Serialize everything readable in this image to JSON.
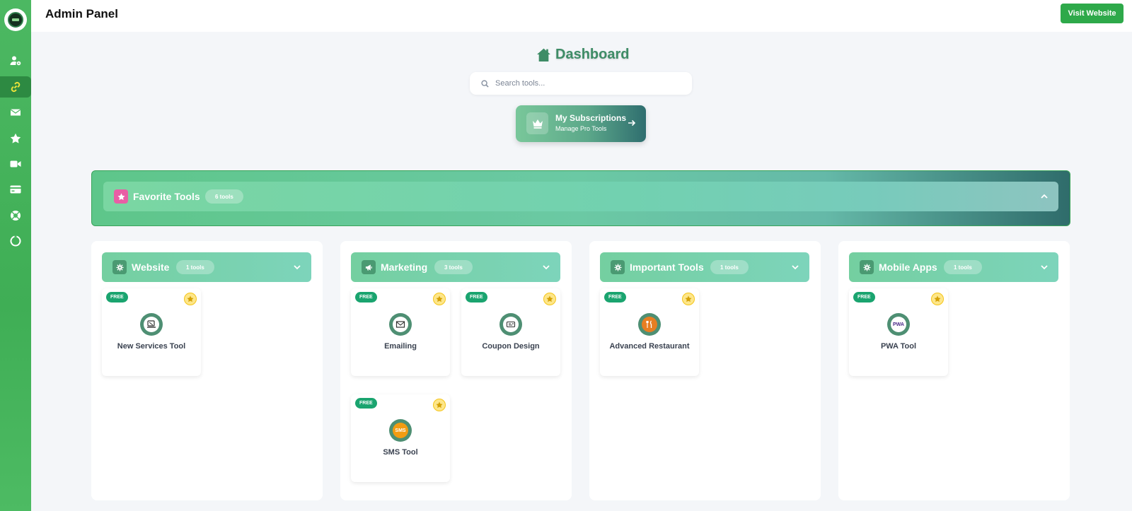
{
  "topbar": {
    "title": "Admin Panel",
    "visit_label": "Visit Website"
  },
  "sidebar": {
    "items": [
      {
        "icon": "user-gear-icon"
      },
      {
        "icon": "link-icon",
        "active": true
      },
      {
        "icon": "envelope-icon"
      },
      {
        "icon": "star-icon"
      },
      {
        "icon": "video-icon"
      },
      {
        "icon": "credit-card-icon"
      },
      {
        "icon": "lifebuoy-icon"
      },
      {
        "icon": "power-icon"
      }
    ]
  },
  "dashboard": {
    "title": "Dashboard"
  },
  "search": {
    "placeholder": "Search tools..."
  },
  "subscriptions": {
    "title": "My Subscriptions",
    "subtitle": "Manage Pro Tools"
  },
  "favorites": {
    "title": "Favorite Tools",
    "count": "6 tools"
  },
  "categories": [
    {
      "title": "Website",
      "count": "1 tools",
      "icon": "gear-icon",
      "tools": [
        {
          "name": "New Services Tool",
          "badge": "FREE",
          "icon": "services-icon"
        }
      ]
    },
    {
      "title": "Marketing",
      "count": "3 tools",
      "icon": "megaphone-icon",
      "tools": [
        {
          "name": "Emailing",
          "badge": "FREE",
          "icon": "envelope-icon"
        },
        {
          "name": "Coupon Design",
          "badge": "FREE",
          "icon": "coupon-icon"
        },
        {
          "name": "SMS Tool",
          "badge": "FREE",
          "icon": "sms-icon",
          "icon_text": "SMS"
        }
      ]
    },
    {
      "title": "Important Tools",
      "count": "1 tools",
      "icon": "gear-icon",
      "tools": [
        {
          "name": "Advanced Restaurant",
          "badge": "FREE",
          "icon": "restaurant-icon"
        }
      ]
    },
    {
      "title": "Mobile Apps",
      "count": "1 tools",
      "icon": "gear-icon",
      "tools": [
        {
          "name": "PWA Tool",
          "badge": "FREE",
          "icon": "pwa-icon",
          "icon_text": "PWA"
        }
      ]
    }
  ],
  "colors": {
    "accent": "#2ea94a",
    "sidebar": "#4cb862",
    "heading": "#3e8c66",
    "badge": "#1aa46f"
  }
}
